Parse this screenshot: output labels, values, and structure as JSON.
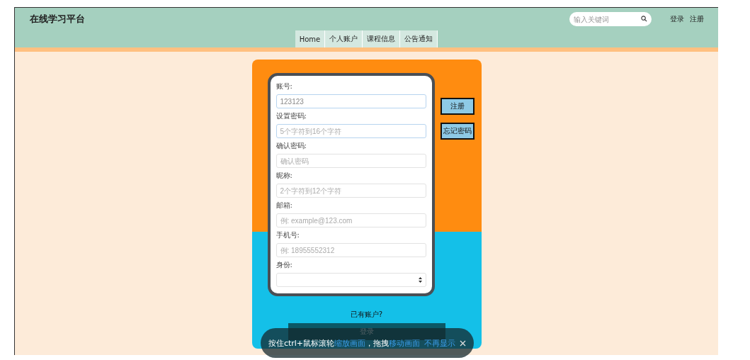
{
  "header": {
    "brand": "在线学习平台",
    "search": {
      "placeholder": "输入关键词"
    },
    "links": [
      "登录",
      "注册"
    ]
  },
  "nav": {
    "tabs": [
      {
        "label": "Home"
      },
      {
        "label": "个人账户"
      },
      {
        "label": "课程信息"
      },
      {
        "label": "公告通知"
      }
    ]
  },
  "form": {
    "fields": [
      {
        "kind": "text",
        "label": "账号:",
        "value": "123123",
        "focused": true
      },
      {
        "kind": "text",
        "label": "设置密码:",
        "placeholder": "5个字符到16个字符",
        "focused": true
      },
      {
        "kind": "text",
        "label": "确认密码:",
        "placeholder": "确认密码",
        "focused": false
      },
      {
        "kind": "text",
        "label": "昵称:",
        "placeholder": "2个字符到12个字符",
        "focused": false
      },
      {
        "kind": "text",
        "label": "邮箱:",
        "placeholder": "例: example@123.com",
        "focused": false
      },
      {
        "kind": "text",
        "label": "手机号:",
        "placeholder": "例: 18955552312",
        "focused": false
      },
      {
        "kind": "select",
        "label": "身份:",
        "focused": false
      }
    ]
  },
  "side_buttons": [
    "注册",
    "忘记密码"
  ],
  "account_prompt": "已有账户?",
  "login_button": "登录",
  "hint_toast": {
    "message": [
      {
        "text": "按住ctrl+鼠标滚轮",
        "highlight": false
      },
      {
        "text": "缩放画面",
        "highlight": true
      },
      {
        "text": "，拖拽",
        "highlight": false
      },
      {
        "text": "移动画面",
        "highlight": true
      }
    ],
    "dismiss": "不再显示"
  }
}
